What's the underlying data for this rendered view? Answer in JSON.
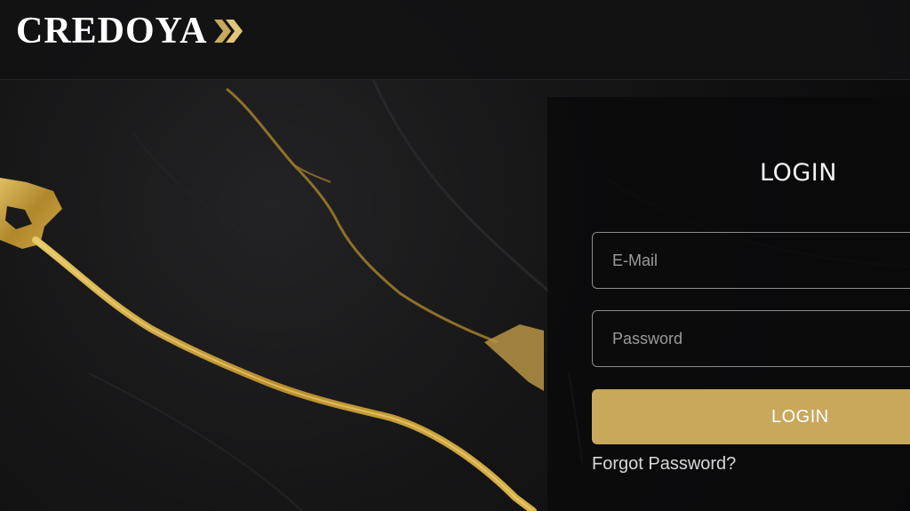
{
  "header": {
    "logo_text": "CREDOYA",
    "logo_icon": "double-chevron-right-icon"
  },
  "login": {
    "title": "LOGIN",
    "email_placeholder": "E-Mail",
    "email_value": "",
    "password_placeholder": "Password",
    "password_value": "",
    "button_label": "LOGIN",
    "forgot_label": "Forgot Password?"
  },
  "colors": {
    "accent_gold": "#c9a85c",
    "background": "#0d0d0e",
    "text_light": "#f2f2f2"
  }
}
